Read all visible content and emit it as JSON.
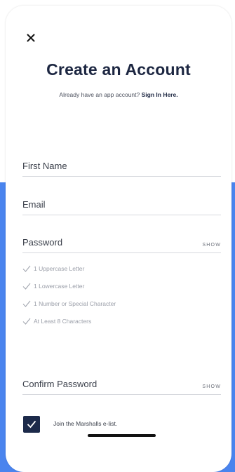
{
  "header": {
    "title": "Create an Account",
    "signin_prompt": "Already have an app account?",
    "signin_link": "Sign In Here."
  },
  "form": {
    "first_name_label": "First Name",
    "email_label": "Email",
    "password_label": "Password",
    "password_show": "SHOW",
    "requirements": [
      "1 Uppercase Letter",
      "1 Lowercase Letter",
      "1 Number or Special Character",
      "At Least 8 Characters"
    ],
    "confirm_password_label": "Confirm Password",
    "confirm_show": "SHOW",
    "elist_label": "Join the Marshalls e-list.",
    "elist_checked": true
  },
  "colors": {
    "brand_navy": "#1c2641",
    "checkbox_fill": "#1c2a4a",
    "background_blue": "#4a84ee"
  },
  "icons": {
    "close": "close-icon",
    "check": "check-icon"
  }
}
